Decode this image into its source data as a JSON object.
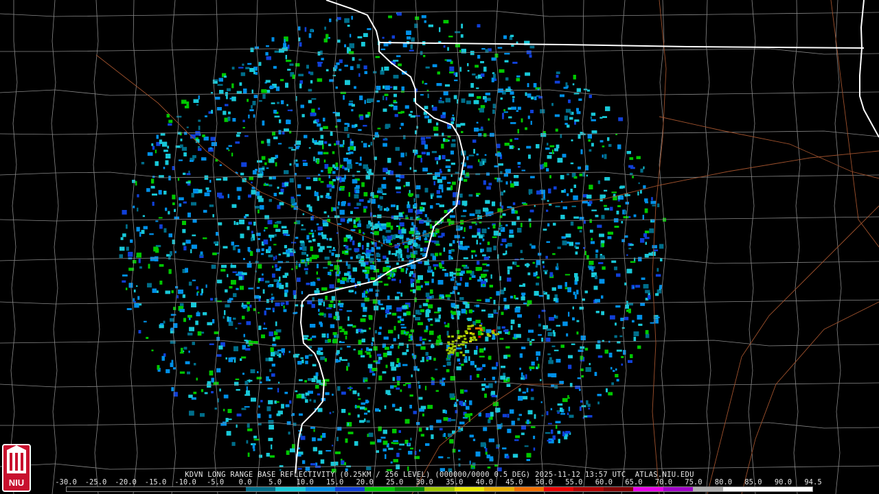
{
  "product": {
    "caption": "KDVN LONG RANGE BASE REFLECTIVITY (0.25KM / 256 LEVEL) (000000/0000 0.5 DEG) 2025-11-12 13:57 UTC  ATLAS.NIU.EDU",
    "logo_text": "NIU"
  },
  "legend": {
    "labels": [
      "-30.0",
      "-25.0",
      "-20.0",
      "-15.0",
      "-10.0",
      "-5.0",
      "0.0",
      "5.0",
      "10.0",
      "15.0",
      "20.0",
      "25.0",
      "30.0",
      "35.0",
      "40.0",
      "45.0",
      "50.0",
      "55.0",
      "60.0",
      "65.0",
      "70.0",
      "75.0",
      "80.0",
      "85.0",
      "90.0",
      "94.5"
    ],
    "colors": [
      "#000000",
      "#000000",
      "#000000",
      "#000000",
      "#000000",
      "#000000",
      "#006e8a",
      "#18c8d8",
      "#0090e8",
      "#1040d8",
      "#00c800",
      "#008800",
      "#a0c800",
      "#e8e800",
      "#e8b000",
      "#f07000",
      "#e80000",
      "#b00000",
      "#800000",
      "#e800e8",
      "#a000c8",
      "#b0b0b0",
      "#ffffff",
      "#ffffff",
      "#ffffff"
    ]
  },
  "map": {
    "state_border_color": "#ffffff",
    "county_line_color": "#8a8a8a",
    "road_color": "#a0522d"
  }
}
